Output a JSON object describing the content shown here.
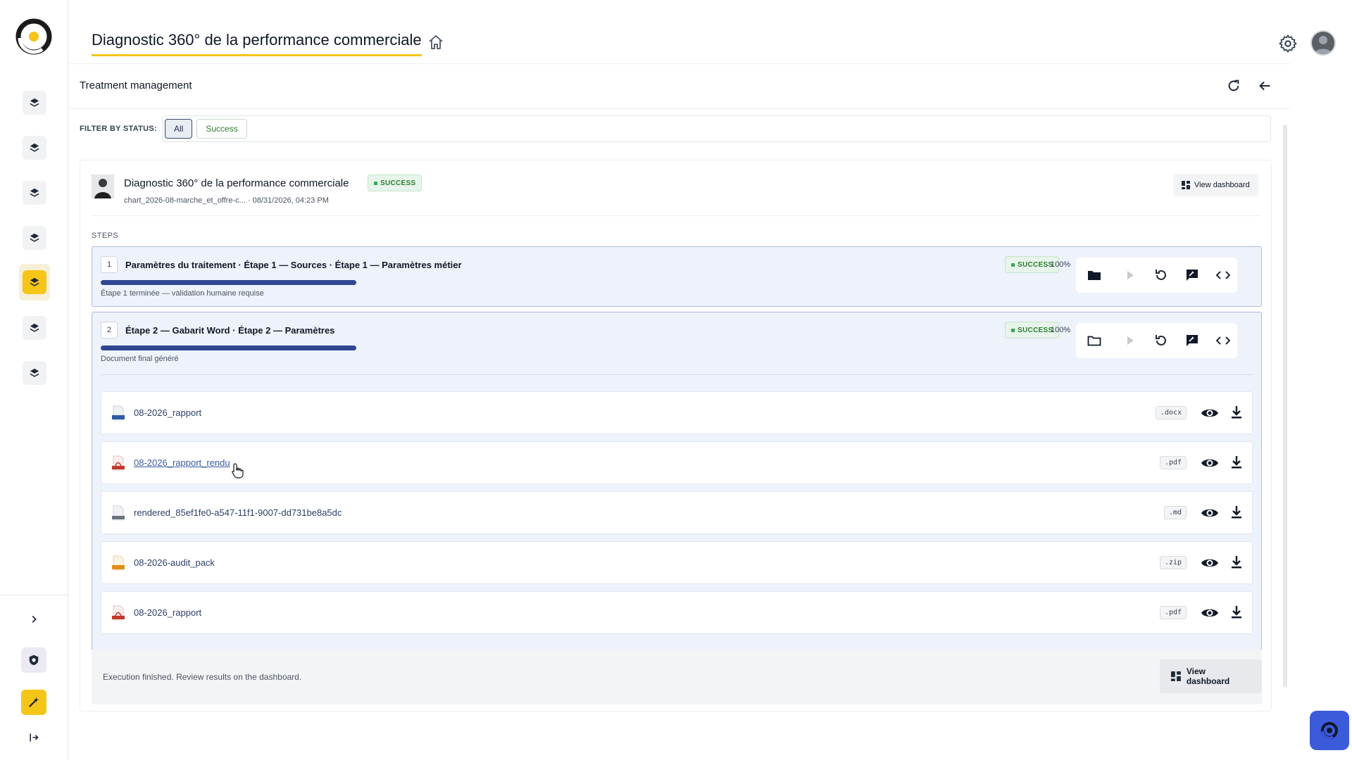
{
  "header": {
    "title": "Diagnostic 360° de la performance commerciale"
  },
  "sidebar": {
    "items": [
      {
        "icon": "layers-icon"
      },
      {
        "icon": "layers-icon"
      },
      {
        "icon": "layers-icon"
      },
      {
        "icon": "layers-icon"
      },
      {
        "icon": "layers-icon",
        "active": true
      },
      {
        "icon": "layers-icon"
      },
      {
        "icon": "layers-icon"
      }
    ]
  },
  "panel": {
    "title": "Treatment management"
  },
  "filter": {
    "label": "FILTER BY STATUS:",
    "options": [
      "All",
      "Success"
    ],
    "selected": "All"
  },
  "treatment": {
    "title": "Diagnostic 360° de la performance commerciale",
    "status": "SUCCESS",
    "source": "chart_2026-08-marche_et_offre-c...",
    "date": "· 08/31/2026, 04:23 PM",
    "view_dashboard": "View dashboard",
    "steps_label": "STEPS",
    "steps": [
      {
        "number": "1",
        "title": "Paramètres du traitement · Étape 1 — Sources · Étape 1 — Paramètres métier",
        "status": "SUCCESS",
        "percent": "100%",
        "progress": 1.0,
        "note": "Étape 1 terminée — validation humaine requise"
      },
      {
        "number": "2",
        "title": "Étape 2 — Gabarit Word · Étape 2 — Paramètres",
        "status": "SUCCESS",
        "percent": "100%",
        "progress": 1.0,
        "note": "Document final généré"
      }
    ],
    "files": [
      {
        "name": "08-2026_rapport",
        "ext": ".docx",
        "icon": "doc-file-icon"
      },
      {
        "name": "08-2026_rapport_rendu",
        "ext": ".pdf",
        "icon": "pdf-file-icon"
      },
      {
        "name": "rendered_85ef1fe0-a547-11f1-9007-dd731be8a5dc",
        "ext": ".md",
        "icon": "md-file-icon"
      },
      {
        "name": "08-2026-audit_pack",
        "ext": ".zip",
        "icon": "zip-file-icon"
      },
      {
        "name": "08-2026_rapport",
        "ext": ".pdf",
        "icon": "pdf-file-icon"
      }
    ],
    "footer_message": "Execution finished. Review results on the dashboard.",
    "footer_button": "View dashboard"
  },
  "colors": {
    "accent": "#f5c518",
    "progress": "#2f4692",
    "success": "#2e7d32",
    "fab": "#3b5bdb"
  }
}
